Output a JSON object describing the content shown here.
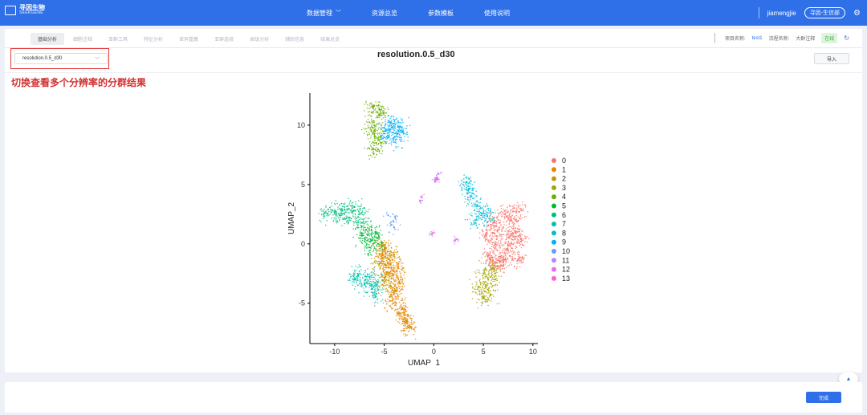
{
  "brand": {
    "name_cn": "寻因生物",
    "name_en": "SEEKGENE"
  },
  "nav": [
    {
      "label": "数据管理",
      "has_dropdown": true
    },
    {
      "label": "资源总览",
      "has_dropdown": false
    },
    {
      "label": "参数模板",
      "has_dropdown": false
    },
    {
      "label": "使用说明",
      "has_dropdown": false
    }
  ],
  "user": {
    "name": "jiamengjie",
    "org": "寻因-生信部",
    "settings_icon": "gear-icon"
  },
  "tabs": [
    {
      "label": "基础分析",
      "active": true
    },
    {
      "label": "细胞注释",
      "active": false
    },
    {
      "label": "亚群工具",
      "active": false
    },
    {
      "label": "特征分析",
      "active": false
    },
    {
      "label": "差异富集",
      "active": false
    },
    {
      "label": "亚群选择",
      "active": false
    },
    {
      "label": "高级分析",
      "active": false
    },
    {
      "label": "辅助信息",
      "active": false
    },
    {
      "label": "结果总览",
      "active": false
    }
  ],
  "project": {
    "name_label": "项目名称:",
    "name_value": "test1",
    "flow_label": "流程名称:",
    "flow_value": "大群注释",
    "status": "在线"
  },
  "resolution_select": {
    "value": "resolution.0.5_d30"
  },
  "import_button": "导入",
  "annotation": "切换查看多个分辨率的分群结果",
  "done_button": "完成",
  "colors": {
    "accent": "#2f6fe8",
    "highlight": "#e53935",
    "annotation": "#d32f2f"
  },
  "chart_data": {
    "type": "scatter",
    "title": "resolution.0.5_d30",
    "xlabel": "UMAP_1",
    "ylabel": "UMAP_2",
    "xlim": [
      -12.5,
      10.5
    ],
    "ylim": [
      -8.4,
      12.7
    ],
    "xticks": [
      -10,
      -5,
      0,
      5,
      10
    ],
    "yticks": [
      -5,
      0,
      5,
      10
    ],
    "xtick_labels": [
      "-10",
      "-5",
      "0",
      "5",
      "10"
    ],
    "ytick_labels": [
      "-5",
      "0",
      "5",
      "10"
    ],
    "legend_position": "right",
    "series": [
      {
        "name": "0",
        "color": "#f8766d",
        "points": [
          [
            7.2,
            2.5
          ],
          [
            8.6,
            2.7
          ],
          [
            6.0,
            1.8
          ],
          [
            7.6,
            0.5
          ],
          [
            8.8,
            0.2
          ],
          [
            6.2,
            0.0
          ],
          [
            7.0,
            -1.2
          ],
          [
            8.5,
            -1.3
          ],
          [
            5.5,
            -1.0
          ],
          [
            6.8,
            -1.8
          ],
          [
            7.8,
            2.0
          ],
          [
            6.4,
            1.1
          ],
          [
            8.2,
            1.0
          ],
          [
            5.3,
            0.8
          ],
          [
            7.4,
            -0.5
          ],
          [
            6.0,
            -1.6
          ]
        ]
      },
      {
        "name": "1",
        "color": "#e58700",
        "points": [
          [
            -5.2,
            -1.0
          ],
          [
            -4.5,
            -2.5
          ],
          [
            -3.8,
            -4.0
          ],
          [
            -3.2,
            -5.5
          ],
          [
            -2.8,
            -6.6
          ],
          [
            -2.5,
            -7.0
          ],
          [
            -4.8,
            -1.8
          ],
          [
            -3.5,
            -3.2
          ],
          [
            -4.2,
            -4.8
          ],
          [
            -3.0,
            -6.0
          ],
          [
            -5.0,
            -0.5
          ],
          [
            -3.6,
            -2.0
          ]
        ]
      },
      {
        "name": "2",
        "color": "#c99800",
        "points": [
          [
            -5.3,
            -0.2
          ],
          [
            -4.6,
            -1.3
          ],
          [
            -4.9,
            -2.8
          ],
          [
            -4.3,
            -3.6
          ],
          [
            -5.5,
            -1.7
          ],
          [
            -4.0,
            -0.9
          ],
          [
            -5.0,
            -3.3
          ]
        ]
      },
      {
        "name": "3",
        "color": "#a3a500",
        "points": [
          [
            5.0,
            -2.5
          ],
          [
            5.3,
            -3.5
          ],
          [
            5.7,
            -4.3
          ],
          [
            5.0,
            -4.6
          ],
          [
            5.9,
            -2.1
          ],
          [
            4.5,
            -3.7
          ],
          [
            6.2,
            -3.0
          ]
        ]
      },
      {
        "name": "4",
        "color": "#6bb100",
        "points": [
          [
            -6.2,
            11.6
          ],
          [
            -5.5,
            10.9
          ],
          [
            -6.0,
            10.0
          ],
          [
            -5.4,
            9.0
          ],
          [
            -6.3,
            9.5
          ],
          [
            -5.8,
            8.5
          ],
          [
            -5.5,
            11.3
          ],
          [
            -6.1,
            8.0
          ]
        ]
      },
      {
        "name": "5",
        "color": "#00ba38",
        "points": [
          [
            -6.8,
            1.2
          ],
          [
            -6.2,
            0.5
          ],
          [
            -5.6,
            0.0
          ],
          [
            -7.2,
            0.7
          ],
          [
            -6.5,
            -0.3
          ],
          [
            -5.9,
            1.0
          ]
        ]
      },
      {
        "name": "6",
        "color": "#00bf7d",
        "points": [
          [
            -11.0,
            2.6
          ],
          [
            -10.0,
            2.7
          ],
          [
            -9.0,
            2.9
          ],
          [
            -8.0,
            3.1
          ],
          [
            -9.5,
            2.4
          ],
          [
            -8.5,
            2.2
          ],
          [
            -7.6,
            1.8
          ],
          [
            -7.3,
            2.6
          ]
        ]
      },
      {
        "name": "7",
        "color": "#00c0af",
        "points": [
          [
            -7.6,
            -2.6
          ],
          [
            -6.5,
            -2.8
          ],
          [
            -5.7,
            -3.2
          ],
          [
            -7.0,
            -3.4
          ],
          [
            -8.0,
            -3.0
          ],
          [
            -6.2,
            -3.8
          ],
          [
            -5.8,
            -4.2
          ]
        ]
      },
      {
        "name": "8",
        "color": "#00bcd8",
        "points": [
          [
            3.3,
            5.2
          ],
          [
            3.8,
            4.0
          ],
          [
            4.4,
            3.2
          ],
          [
            5.0,
            2.6
          ],
          [
            4.2,
            2.0
          ],
          [
            5.4,
            2.3
          ],
          [
            3.5,
            4.6
          ]
        ]
      },
      {
        "name": "9",
        "color": "#00b0f6",
        "points": [
          [
            -4.2,
            9.8
          ],
          [
            -3.4,
            9.9
          ],
          [
            -4.6,
            9.1
          ],
          [
            -3.8,
            8.8
          ],
          [
            -4.9,
            9.5
          ],
          [
            -3.2,
            9.4
          ],
          [
            -4.4,
            10.2
          ]
        ]
      },
      {
        "name": "10",
        "color": "#619cff",
        "points": [
          [
            -4.6,
            2.4
          ],
          [
            -4.1,
            1.9
          ],
          [
            -4.3,
            1.6
          ],
          [
            -3.9,
            2.2
          ],
          [
            -4.0,
            1.4
          ]
        ]
      },
      {
        "name": "11",
        "color": "#b983ff",
        "points": [
          [
            0.3,
            5.6
          ],
          [
            0.1,
            5.3
          ],
          [
            -1.4,
            3.6
          ],
          [
            2.1,
            0.3
          ],
          [
            -0.2,
            0.8
          ],
          [
            0.5,
            5.9
          ]
        ]
      },
      {
        "name": "12",
        "color": "#e76bf3",
        "points": [
          [
            -1.2,
            3.9
          ],
          [
            2.3,
            0.4
          ],
          [
            0.2,
            5.5
          ]
        ]
      },
      {
        "name": "13",
        "color": "#fd61d1",
        "points": [
          [
            -0.1,
            0.9
          ],
          [
            0.4,
            5.4
          ]
        ]
      }
    ]
  }
}
